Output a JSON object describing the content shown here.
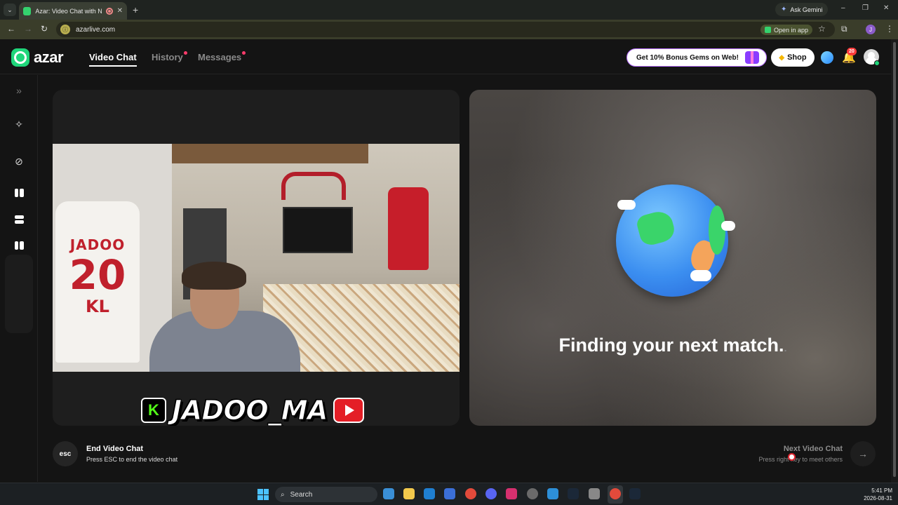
{
  "browser": {
    "tab_title": "Azar: Video Chat with New",
    "new_tab": "+",
    "ask_gemini": "Ask Gemini",
    "url": "azarlive.com",
    "open_in_app": "Open in app",
    "profile_initial": "J",
    "window_controls": {
      "minimize": "–",
      "restore": "❐",
      "close": "✕"
    }
  },
  "header": {
    "logo": "azar",
    "nav": [
      {
        "label": "Video Chat",
        "active": true
      },
      {
        "label": "History",
        "dot": true
      },
      {
        "label": "Messages",
        "dot": true
      }
    ],
    "promo": "Get 10% Bonus Gems on Web!",
    "shop": "Shop",
    "notification_count": "20"
  },
  "sidebar": {
    "items": [
      "expand-icon",
      "magic-wand-icon",
      "no-filter-icon",
      "layout-side-by-side-icon",
      "layout-stacked-icon",
      "layout-grid-icon"
    ]
  },
  "left_panel": {
    "jersey": {
      "name": "JADOO",
      "number": "20",
      "initials": "KL"
    },
    "watermark": {
      "kick_letter": "K",
      "text": "JADOO_MA"
    }
  },
  "right_panel": {
    "status": "Finding your next match.",
    "status_trailing_dot": "."
  },
  "controls": {
    "esc_label": "esc",
    "end_title": "End Video Chat",
    "end_sub": "Press ESC to end the video chat",
    "next_title": "Next Video Chat",
    "next_sub": "Press right key to meet others",
    "next_arrow": "→"
  },
  "taskbar": {
    "search": "Search",
    "time": "5:41 PM",
    "date": "2026-08-31"
  },
  "colors": {
    "brand_green": "#1fd67a",
    "notification_red": "#ff3b3b",
    "promo_border": "#b46cff"
  }
}
